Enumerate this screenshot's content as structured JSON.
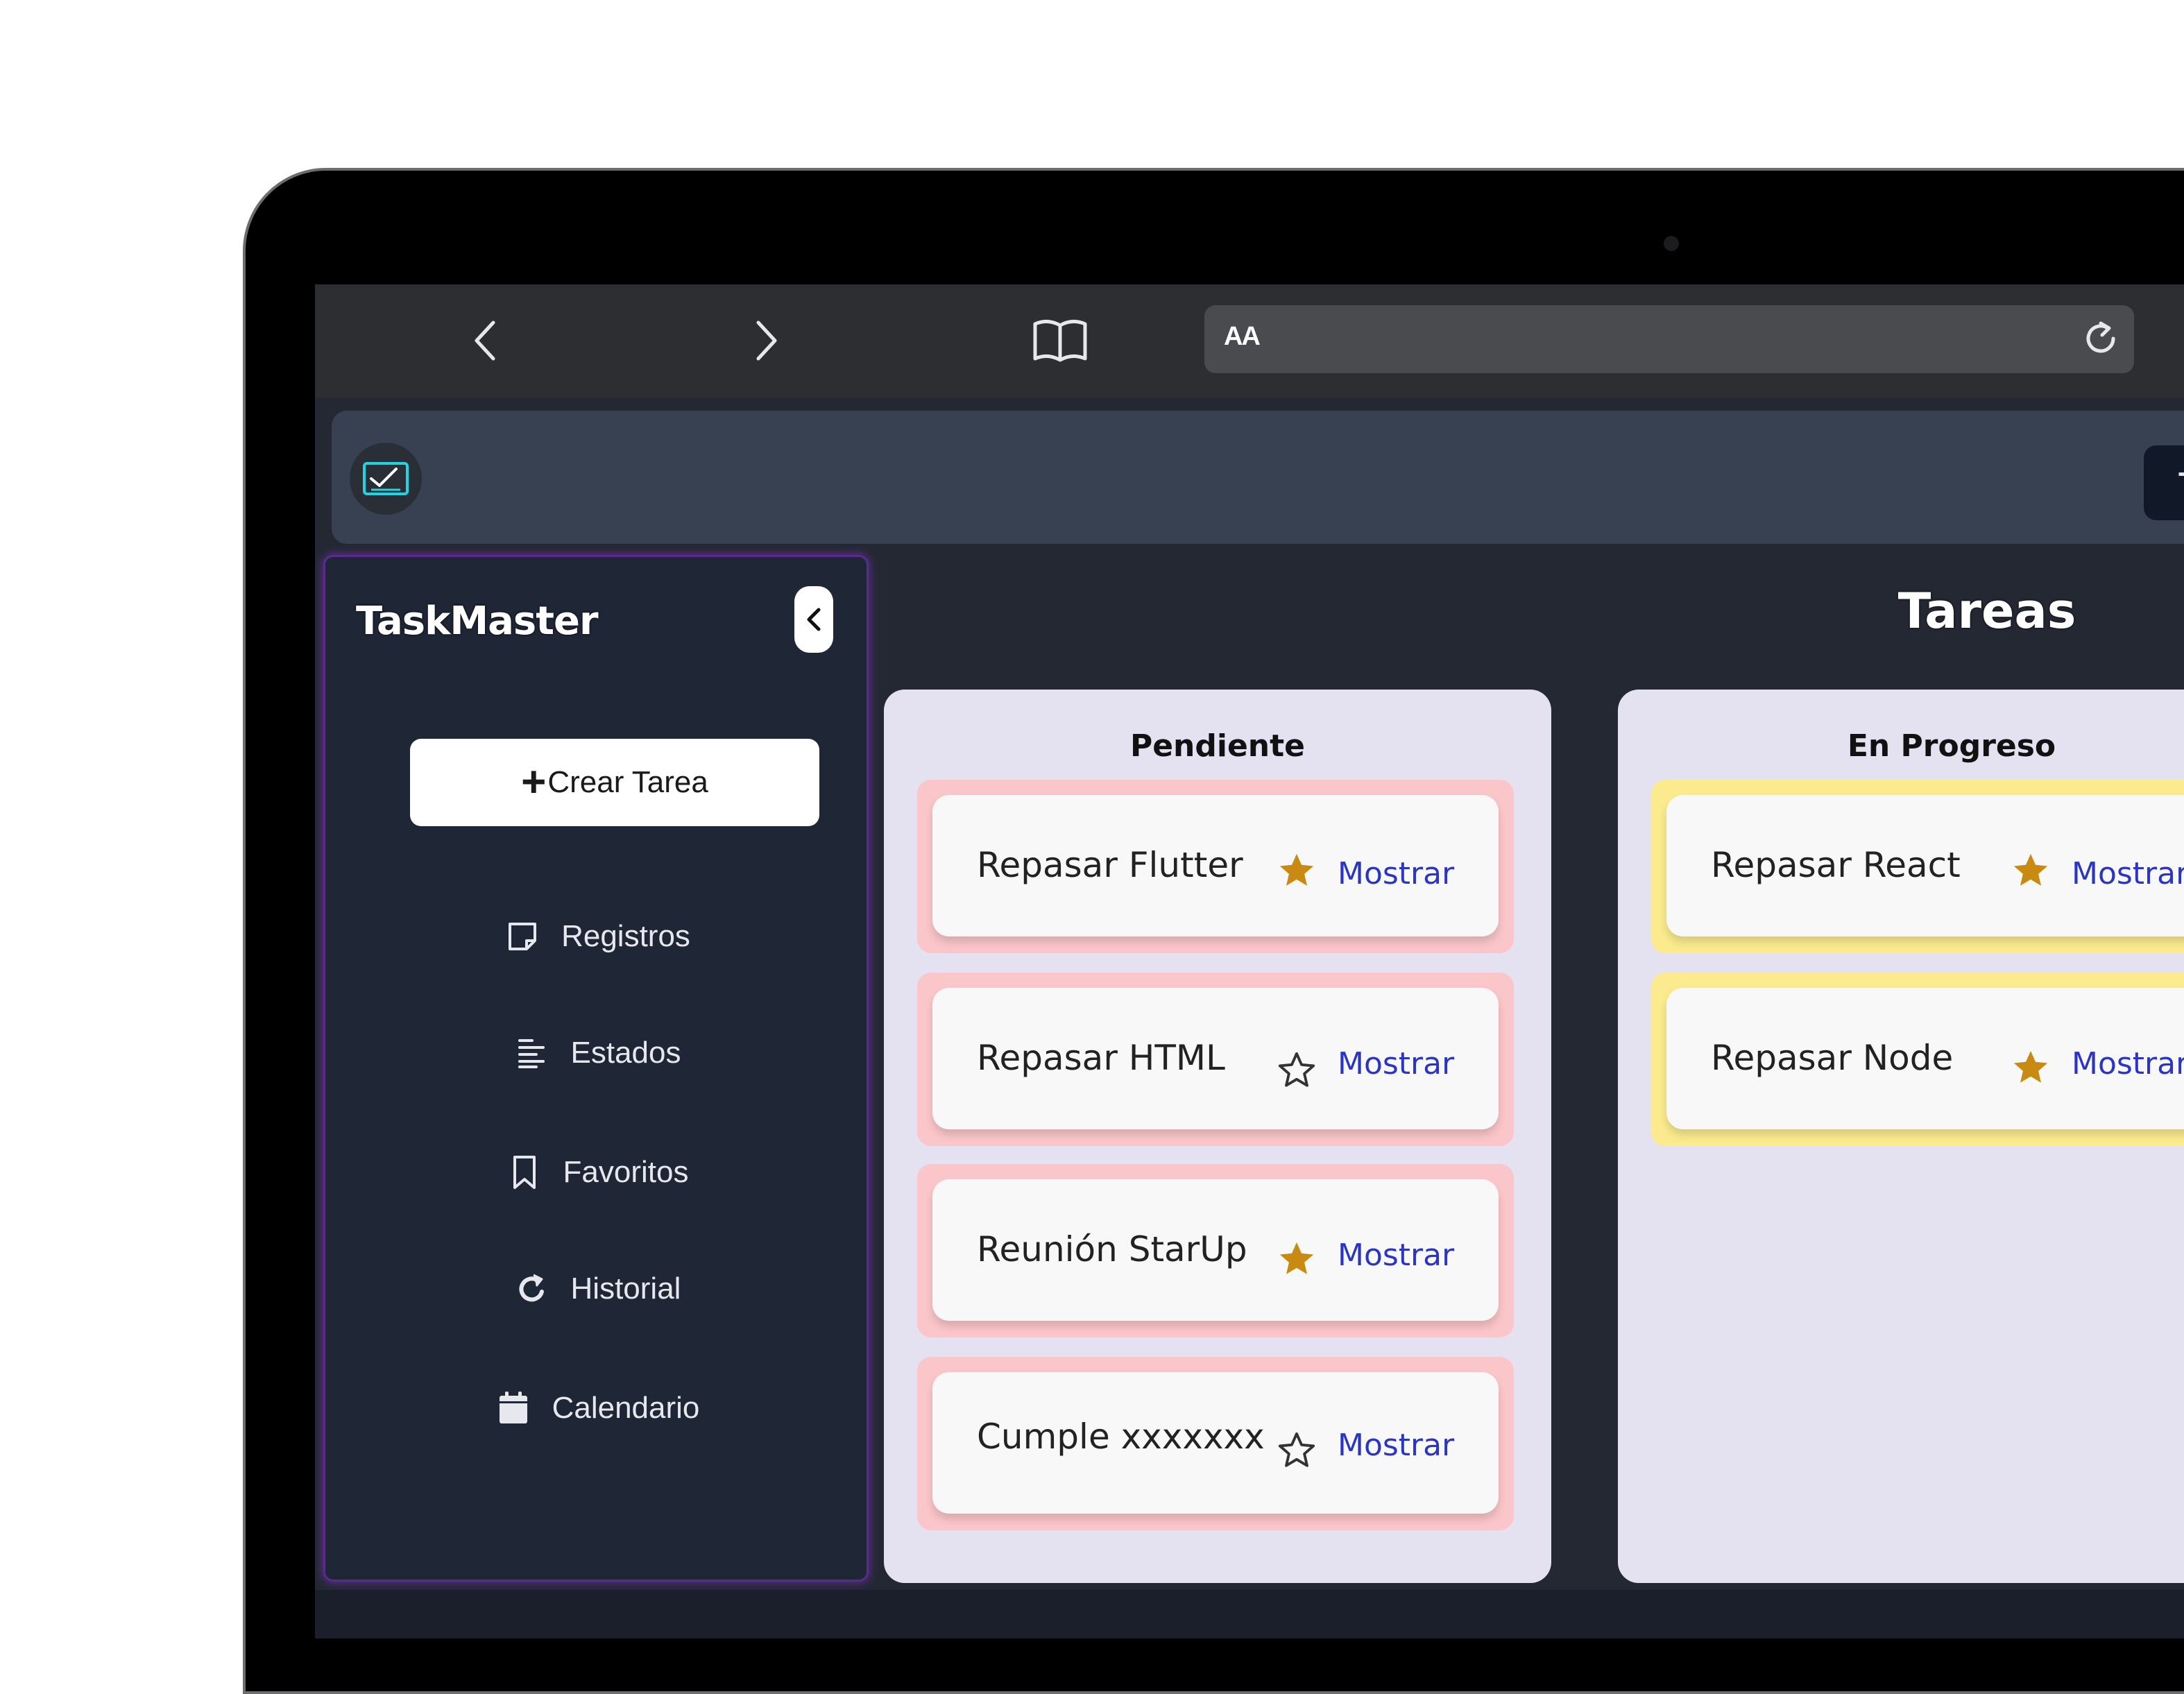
{
  "browser": {
    "text_size_label": "AA"
  },
  "appbar": {
    "topright_button_label": "T"
  },
  "sidebar": {
    "title": "TaskMaster",
    "create_button": {
      "plus": "+",
      "label": "Crear Tarea"
    },
    "items": [
      {
        "label": "Registros",
        "icon": "note-icon"
      },
      {
        "label": "Estados",
        "icon": "list-icon"
      },
      {
        "label": "Favoritos",
        "icon": "bookmark-icon"
      },
      {
        "label": "Historial",
        "icon": "refresh-icon"
      },
      {
        "label": "Calendario",
        "icon": "calendar-icon"
      }
    ]
  },
  "main": {
    "title": "Tareas",
    "columns": [
      {
        "title": "Pendiente",
        "color": "#fbc6c9",
        "tasks": [
          {
            "name": "Repasar Flutter",
            "favorite": true,
            "action": "Mostrar"
          },
          {
            "name": "Repasar HTML",
            "favorite": false,
            "action": "Mostrar"
          },
          {
            "name": "Reunión StarUp",
            "favorite": true,
            "action": "Mostrar"
          },
          {
            "name": "Cumple xxxxxxx",
            "favorite": false,
            "action": "Mostrar"
          }
        ]
      },
      {
        "title": "En Progreso",
        "color": "#fbeb8e",
        "tasks": [
          {
            "name": "Repasar React",
            "favorite": true,
            "action": "Mostrar"
          },
          {
            "name": "Repasar Node",
            "favorite": true,
            "action": "Mostrar"
          }
        ]
      }
    ]
  },
  "colors": {
    "star_filled": "#c98a12",
    "link": "#2b35c4",
    "sidebar_border": "#5b2b8a"
  }
}
